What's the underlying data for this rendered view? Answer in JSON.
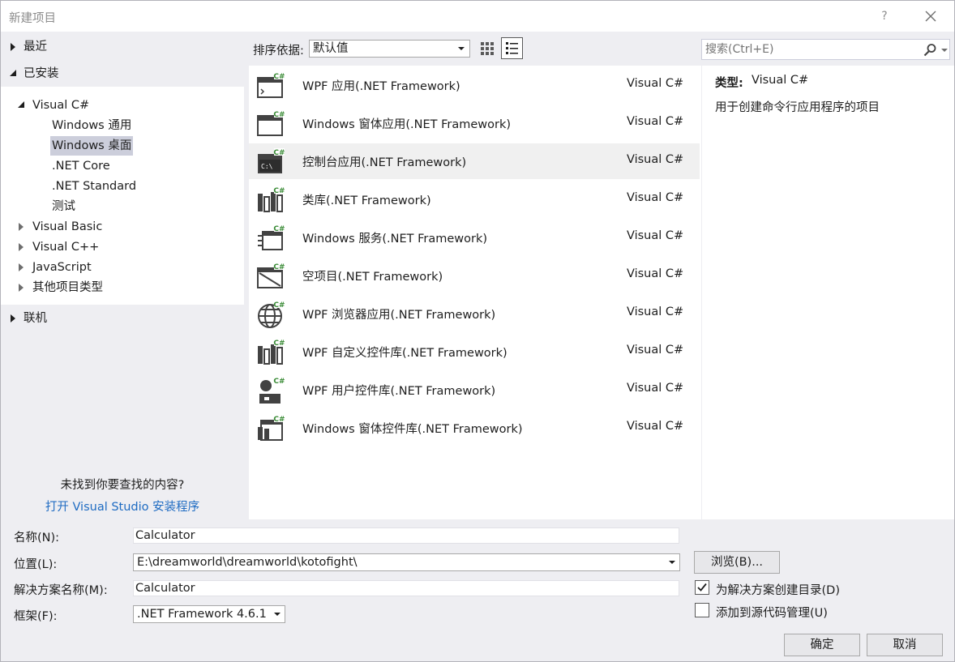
{
  "window": {
    "title": "新建项目",
    "help_label": "?",
    "close_label": "✕"
  },
  "nav": {
    "recent": "最近",
    "installed": "已安装",
    "tree": {
      "visual_csharp": "Visual C#",
      "children": [
        "Windows 通用",
        "Windows 桌面",
        ".NET Core",
        ".NET Standard",
        "测试"
      ],
      "selected_child": "Windows 桌面",
      "siblings": [
        "Visual Basic",
        "Visual C++",
        "JavaScript",
        "其他项目类型"
      ]
    },
    "online": "联机",
    "not_found_text": "未找到你要查找的内容?",
    "installer_link": "打开 Visual Studio 安装程序"
  },
  "toolbar": {
    "sort_label": "排序依据:",
    "sort_value": "默认值",
    "search_placeholder": "搜索(Ctrl+E)"
  },
  "templates": [
    {
      "name": "WPF 应用(.NET Framework)",
      "lang": "Visual C#",
      "icon": "wpf-app-icon"
    },
    {
      "name": "Windows 窗体应用(.NET Framework)",
      "lang": "Visual C#",
      "icon": "winforms-app-icon"
    },
    {
      "name": "控制台应用(.NET Framework)",
      "lang": "Visual C#",
      "icon": "console-app-icon"
    },
    {
      "name": "类库(.NET Framework)",
      "lang": "Visual C#",
      "icon": "class-library-icon"
    },
    {
      "name": "Windows 服务(.NET Framework)",
      "lang": "Visual C#",
      "icon": "windows-service-icon"
    },
    {
      "name": "空项目(.NET Framework)",
      "lang": "Visual C#",
      "icon": "empty-project-icon"
    },
    {
      "name": "WPF 浏览器应用(.NET Framework)",
      "lang": "Visual C#",
      "icon": "wpf-browser-app-icon"
    },
    {
      "name": "WPF 自定义控件库(.NET Framework)",
      "lang": "Visual C#",
      "icon": "wpf-custom-control-library-icon"
    },
    {
      "name": "WPF 用户控件库(.NET Framework)",
      "lang": "Visual C#",
      "icon": "wpf-user-control-library-icon"
    },
    {
      "name": "Windows 窗体控件库(.NET Framework)",
      "lang": "Visual C#",
      "icon": "winforms-control-library-icon"
    }
  ],
  "selected_template_index": 2,
  "details": {
    "type_label": "类型:",
    "type_value": "Visual C#",
    "description": "用于创建命令行应用程序的项目"
  },
  "form": {
    "name_label": "名称(N):",
    "name_value": "Calculator",
    "location_label": "位置(L):",
    "location_value": "E:\\dreamworld\\dreamworld\\kotofight\\",
    "solution_label": "解决方案名称(M):",
    "solution_value": "Calculator",
    "framework_label": "框架(F):",
    "framework_value": ".NET Framework 4.6.1",
    "browse_label": "浏览(B)...",
    "create_dir_label": "为解决方案创建目录(D)",
    "create_dir_checked": true,
    "source_control_label": "添加到源代码管理(U)",
    "source_control_checked": false,
    "ok_label": "确定",
    "cancel_label": "取消"
  },
  "colors": {
    "accent_green": "#388a34",
    "link_blue": "#1e6bc2",
    "selection": "#cccedb",
    "dialog_bg": "#eeeef2"
  }
}
